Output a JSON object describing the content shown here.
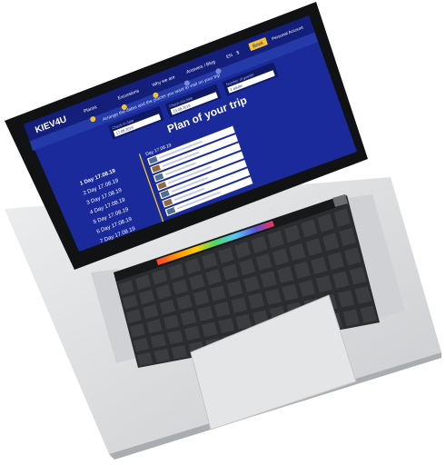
{
  "site": {
    "logo": "KIEV4U",
    "nav": [
      "Places",
      "Excursions",
      "Why we are",
      "Answers / Blog"
    ],
    "nav_extra": [
      "EN",
      "$"
    ],
    "nav_cta": "Book",
    "account": "Personal Account",
    "tagline": "Arrange the dates and the places you want to visit on your trip",
    "filters": [
      {
        "label": "Check-in date",
        "value": "17.08.2019"
      },
      {
        "label": "Check-out date",
        "value": "23.08.2019"
      },
      {
        "label": "Number of guests",
        "value": "2 adults"
      }
    ]
  },
  "plan": {
    "title": "Plan of your trip",
    "days": [
      "1 Day  17.08.19",
      "2 Day  17.08.19",
      "3 Day  17.08.19",
      "4 Day  17.08.19",
      "5 Day  17.08.19",
      "6 Day  17.08.19",
      "7 Day  17.08.19"
    ],
    "detail_header": "Day 17.08.19",
    "rows": 7
  },
  "colors": {
    "screen_bg": "#1a2a9a",
    "header_bg": "#131f7a",
    "accent": "#f2c230",
    "laptop_body": "#d8dadd",
    "keyboard": "#2f3033",
    "key": "#3b3c40"
  },
  "icons": [
    "laptop-icon",
    "touch-bar-rainbow-icon",
    "touch-id-icon"
  ]
}
